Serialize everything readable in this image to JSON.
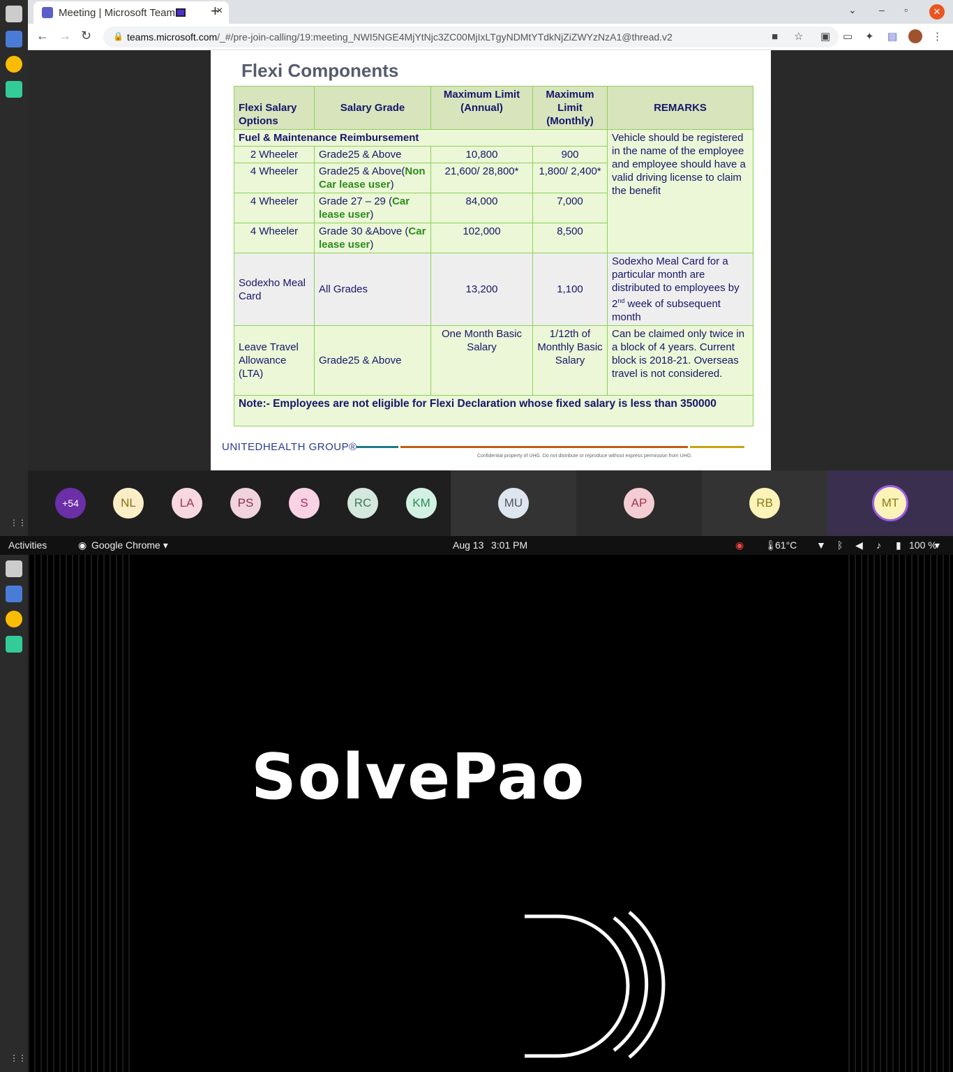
{
  "browser": {
    "tab_title": "Meeting | Microsoft Teams",
    "new_tab": "+",
    "tab_close": "×",
    "url_host": "teams.microsoft.com",
    "url_path": "/_#/pre-join-calling/19:meeting_NWI5NGE4MjYtNjc3ZC00MjIxLTgyNDMtYTdkNjZiZWYzNzA1@thread.v2"
  },
  "slide": {
    "title": "Flexi Components",
    "headers": [
      "Flexi Salary Options",
      "Salary Grade",
      "Maximum  Limit (Annual)",
      "Maximum Limit (Monthly)",
      "REMARKS"
    ],
    "fuel_section": "Fuel & Maintenance Reimbursement",
    "fuel_remark": "Vehicle should be registered in  the name of the employee and employee should have a valid  driving license to claim the  benefit",
    "rows": [
      {
        "option": "2 Wheeler",
        "grade": "Grade25 & Above",
        "grade_note": "",
        "annual": "10,800",
        "monthly": "900"
      },
      {
        "option": "4 Wheeler",
        "grade": "Grade25 & Above(",
        "grade_note": "Non Car lease user",
        "grade_tail": ")",
        "annual": "21,600/ 28,800*",
        "monthly": "1,800/ 2,400*"
      },
      {
        "option": "4 Wheeler",
        "grade": "Grade 27 – 29 (",
        "grade_note": "Car lease user",
        "grade_tail": ")",
        "annual": "84,000",
        "monthly": "7,000"
      },
      {
        "option": "4 Wheeler",
        "grade": "Grade 30 &Above (",
        "grade_note": "Car lease user",
        "grade_tail": ")",
        "annual": "102,000",
        "monthly": "8,500"
      }
    ],
    "meal": {
      "option": "Sodexho Meal Card",
      "grade": "All Grades",
      "annual": "13,200",
      "monthly": "1,100",
      "remark_a": "Sodexho Meal Card for a particular month are distributed  to employees by 2",
      "remark_sup": "nd",
      "remark_b": " week of subsequent month"
    },
    "lta": {
      "option": "Leave Travel Allowance (LTA)",
      "grade": "Grade25 & Above",
      "annual": "One  Month Basic  Salary",
      "monthly": "1/12th of Monthly Basic Salary",
      "remark": "Can be claimed only twice in a  block of 4 years. Current block  is 2018-21. Overseas travel is  not considered."
    },
    "note": "Note:- Employees are not eligible for Flexi Declaration whose fixed salary is less than 350000",
    "brand": "UNITEDHEALTH GROUP®",
    "confidential": "Confidential property of UHG. Do not distribute or reproduce without express permission from UHG."
  },
  "participants": {
    "overflow": "+54",
    "initials": [
      "NL",
      "LA",
      "PS",
      "S",
      "RC",
      "KM",
      "MU",
      "AP",
      "RB",
      "MT"
    ]
  },
  "system_bar": {
    "activities": "Activities",
    "app": "Google Chrome ▾",
    "date": "Aug 13",
    "time": "3:01 PM",
    "temp": "61°C",
    "battery": "100 %"
  },
  "splash": {
    "logo": "SolvePao"
  },
  "colors": {
    "accent": "#5b5fc7",
    "close": "#e95420"
  }
}
